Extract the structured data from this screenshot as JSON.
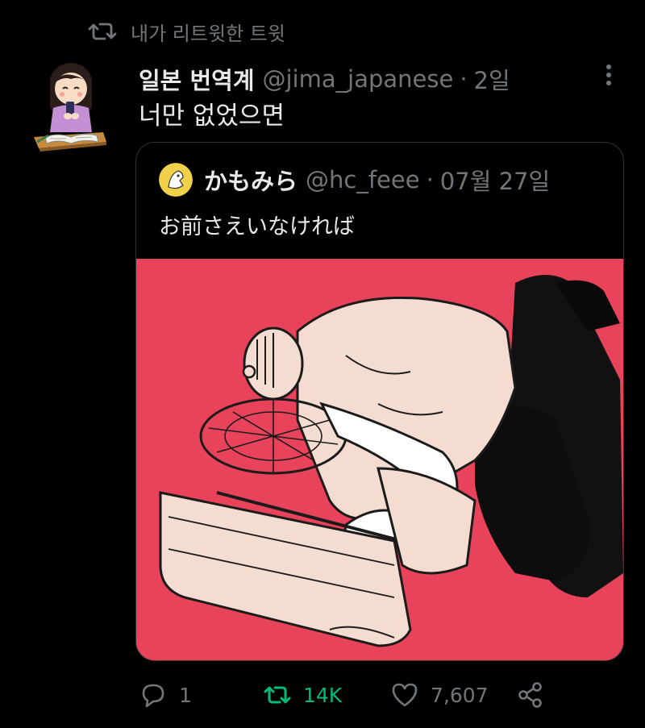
{
  "retweet_context": {
    "label": "내가 리트윗한 트윗",
    "icon": "retweet-icon"
  },
  "tweet": {
    "display_name": "일본 번역계",
    "handle": "@jima_japanese",
    "separator": "·",
    "time": "2일",
    "text": "너만 없었으면",
    "avatar": "avatar-girl-studying-illustration",
    "more_icon": "more-vertical-icon"
  },
  "quote": {
    "display_name": "かもみら",
    "handle": "@hc_feee",
    "separator": "·",
    "time": "07월 27일",
    "text": "お前さえいなければ",
    "media": "illustration-person-hugging-fan-and-air-conditioner",
    "media_background": "#e8435a"
  },
  "actions": {
    "reply": {
      "icon": "reply-icon",
      "count": "1"
    },
    "retweet": {
      "icon": "retweet-icon",
      "count": "14K",
      "active": true
    },
    "like": {
      "icon": "heart-icon",
      "count": "7,607"
    },
    "share": {
      "icon": "share-icon"
    }
  },
  "colors": {
    "background": "#000000",
    "text_primary": "#e7e9ea",
    "text_secondary": "#71767b",
    "retweet_active": "#00ba7c",
    "border": "#2f3336"
  }
}
